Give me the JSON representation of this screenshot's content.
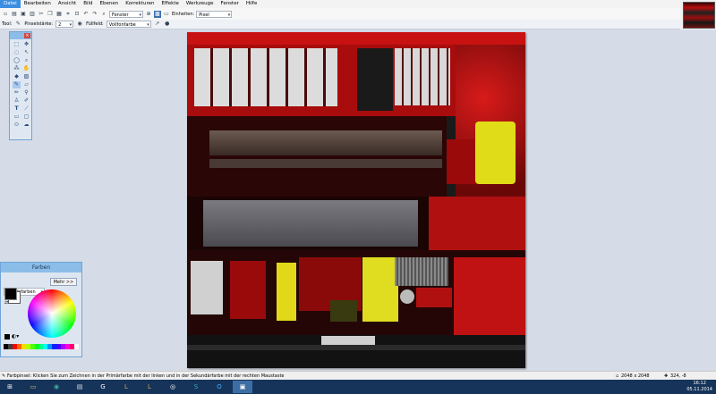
{
  "menu": [
    "Datei",
    "Bearbeiten",
    "Ansicht",
    "Bild",
    "Ebenen",
    "Korrekturen",
    "Effekte",
    "Werkzeuge",
    "Fenster",
    "Hilfe"
  ],
  "toolbar": {
    "zoom_value": "Fenster",
    "units_label": "Einheiten:",
    "units_value": "Pixel"
  },
  "options_bar": {
    "tool_label": "Tool:",
    "brush_width_label": "Pinselstärke:",
    "brush_width_value": "2",
    "fill_label": "Füllfeld:",
    "fill_value": "Vollfonfarbe"
  },
  "colors_window": {
    "title": "Farben",
    "mode_value": "Primärfarben",
    "more_button": "Mehr >>"
  },
  "status": {
    "hint": "Farbpinsel: Klicken Sie zum Zeichnen in der Primärfarbe mit der linken und in der Sekundärfarbe mit der rechten Maustaste",
    "image_size": "2048 x 2048",
    "cursor_pos": "324, -8"
  },
  "taskbar": {
    "time": "16:12",
    "date": "05.11.2014",
    "apps": [
      "explorer-icon",
      "chrome-icon",
      "notepad-icon",
      "logitech-icon",
      "lol-icon",
      "lol-icon",
      "steam-icon",
      "skype-icon",
      "outlook-icon",
      "paint-net-icon"
    ]
  },
  "palette_colors": [
    "#000000",
    "#404040",
    "#ff0000",
    "#ff6a00",
    "#ffd800",
    "#b6ff00",
    "#4cff00",
    "#00ff21",
    "#00ff90",
    "#00ffff",
    "#0094ff",
    "#0026ff",
    "#4800ff",
    "#b200ff",
    "#ff00dc",
    "#ff006e",
    "#ffffff"
  ]
}
